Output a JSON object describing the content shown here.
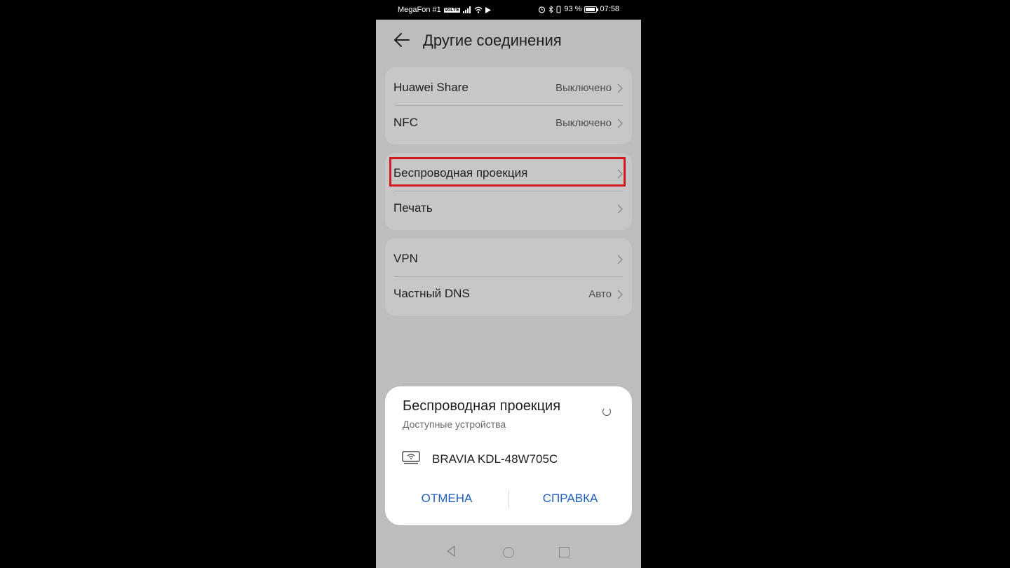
{
  "status_bar": {
    "carrier": "MegaFon #1",
    "volte": "VoLTE",
    "battery_percent": "93 %",
    "battery_level": 0.93,
    "time": "07:58"
  },
  "header": {
    "title": "Другие соединения"
  },
  "settings": {
    "group1": [
      {
        "label": "Huawei Share",
        "value": "Выключено"
      },
      {
        "label": "NFC",
        "value": "Выключено"
      }
    ],
    "group2": [
      {
        "label": "Беспроводная проекция",
        "value": ""
      },
      {
        "label": "Печать",
        "value": ""
      }
    ],
    "group3": [
      {
        "label": "VPN",
        "value": ""
      },
      {
        "label": "Частный DNS",
        "value": "Авто"
      }
    ]
  },
  "highlight": {
    "color": "#d11b20",
    "target": "Беспроводная проекция"
  },
  "dialog": {
    "title": "Беспроводная проекция",
    "subtitle": "Доступные устройства",
    "devices": [
      {
        "name": "BRAVIA KDL-48W705C",
        "icon": "tv-wifi-icon"
      }
    ],
    "cancel_label": "ОТМЕНА",
    "help_label": "СПРАВКА",
    "button_color": "#1f5fbf"
  }
}
